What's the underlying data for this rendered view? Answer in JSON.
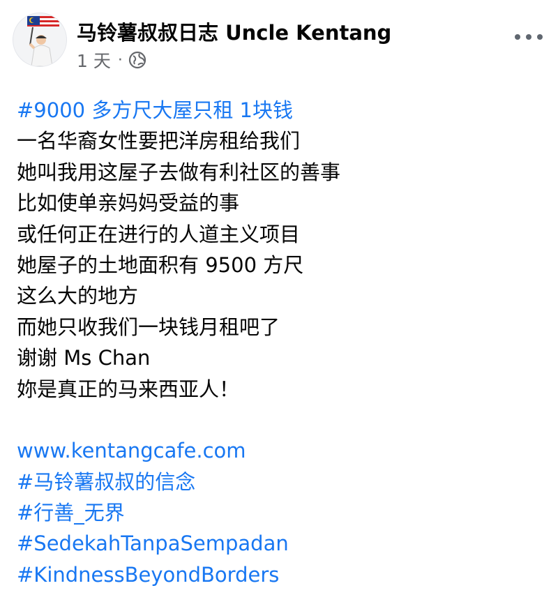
{
  "header": {
    "page_name": "马铃薯叔叔日志 Uncle Kentang",
    "timestamp": "1 天",
    "separator": "·",
    "privacy_icon": "globe-icon",
    "more_icon": "more-horizontal-icon"
  },
  "post": {
    "hashtag_title": "#9000 多方尺大屋只租 1块钱",
    "lines": [
      "一名华裔女性要把洋房租给我们",
      "她叫我用这屋子去做有利社区的善事",
      "比如使单亲妈妈受益的事",
      "或任何正在进行的人道主义项目",
      "她屋子的土地面积有 9500 方尺",
      "这么大的地方",
      "而她只收我们一块钱月租吧了",
      "谢谢 Ms Chan",
      "妳是真正的马来西亚人！"
    ],
    "website": "www.kentangcafe.com",
    "hashtags": [
      "#马铃薯叔叔的信念",
      "#行善_无界",
      "#SedekahTanpaSempadan",
      "#KindnessBeyondBorders"
    ]
  },
  "colors": {
    "link": "#1877f2",
    "text": "#050505",
    "meta": "#65676b"
  }
}
